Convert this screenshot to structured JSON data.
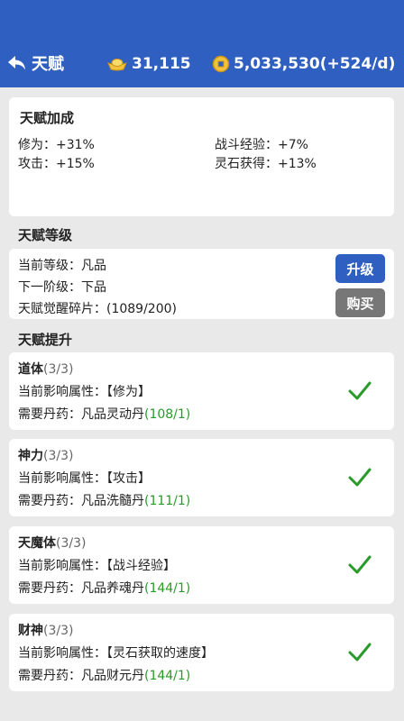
{
  "header": {
    "title": "天赋",
    "ingot_amount": "31,115",
    "coin_amount": "5,033,530(+524/d)",
    "icons": [
      "back-arrow-icon",
      "silver-ingot-icon",
      "coin-icon"
    ]
  },
  "bonus": {
    "title": "天赋加成",
    "items": [
      {
        "label": "修为：+31%"
      },
      {
        "label": "战斗经验：+7%"
      },
      {
        "label": "攻击：+15%"
      },
      {
        "label": "灵石获得：+13%"
      }
    ]
  },
  "level": {
    "section_title": "天赋等级",
    "current": "当前等级：凡品",
    "next": "下一阶级：下品",
    "fragments": "天赋觉醒碎片：(1089/200)",
    "upgrade_label": "升级",
    "buy_label": "购买"
  },
  "upgrade": {
    "section_title": "天赋提升",
    "talents": [
      {
        "name": "道体",
        "count": "(3/3)",
        "attr": "当前影响属性：【修为】",
        "pill_prefix": "需要丹药：凡品灵动丹",
        "pill_progress": "(108/1)"
      },
      {
        "name": "神力",
        "count": "(3/3)",
        "attr": "当前影响属性：【攻击】",
        "pill_prefix": "需要丹药：凡品洗髓丹",
        "pill_progress": "(111/1)"
      },
      {
        "name": "天魔体",
        "count": "(3/3)",
        "attr": "当前影响属性：【战斗经验】",
        "pill_prefix": "需要丹药：凡品养魂丹",
        "pill_progress": "(144/1)"
      },
      {
        "name": "财神",
        "count": "(3/3)",
        "attr": "当前影响属性：【灵石获取的速度】",
        "pill_prefix": "需要丹药：凡品财元丹",
        "pill_progress": "(144/1)"
      }
    ]
  },
  "colors": {
    "header_blue": "#2f5fc0",
    "check_green": "#2a9a2a",
    "progress_green": "#2a9a2a",
    "buy_gray": "#777777"
  }
}
